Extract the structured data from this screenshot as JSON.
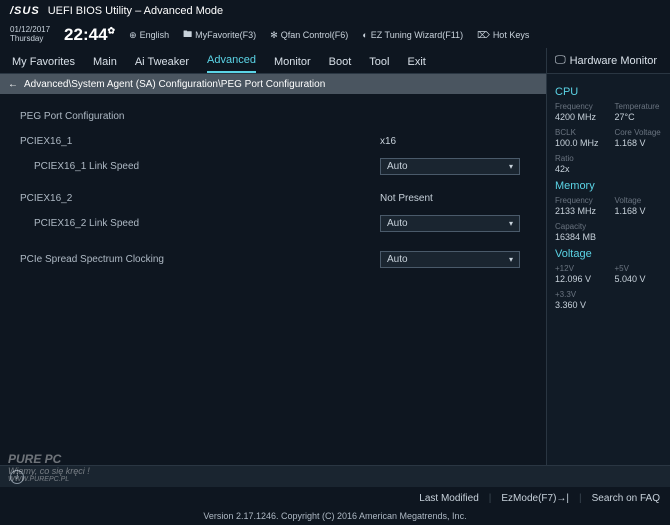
{
  "header": {
    "brand": "/SUS",
    "title": "UEFI BIOS Utility – Advanced Mode"
  },
  "top": {
    "date": "01/12/2017",
    "day": "Thursday",
    "time": "22:44",
    "lang": "English",
    "fav": "MyFavorite(F3)",
    "qfan": "Qfan Control(F6)",
    "ez": "EZ Tuning Wizard(F11)",
    "hot": "Hot Keys"
  },
  "tabs": [
    "My Favorites",
    "Main",
    "Ai Tweaker",
    "Advanced",
    "Monitor",
    "Boot",
    "Tool",
    "Exit"
  ],
  "activeTab": 3,
  "breadcrumb": "Advanced\\System Agent (SA) Configuration\\PEG Port Configuration",
  "rows": {
    "heading": "PEG Port Configuration",
    "p1": "PCIEX16_1",
    "p1v": "x16",
    "p1s": "PCIEX16_1 Link Speed",
    "p1sv": "Auto",
    "p2": "PCIEX16_2",
    "p2v": "Not Present",
    "p2s": "PCIEX16_2 Link Speed",
    "p2sv": "Auto",
    "ssc": "PCIe Spread Spectrum Clocking",
    "sscv": "Auto"
  },
  "hw": {
    "title": "Hardware Monitor",
    "cpu": {
      "h": "CPU",
      "freq_l": "Frequency",
      "freq": "4200 MHz",
      "temp_l": "Temperature",
      "temp": "27°C",
      "bclk_l": "BCLK",
      "bclk": "100.0 MHz",
      "cv_l": "Core Voltage",
      "cv": "1.168 V",
      "ratio_l": "Ratio",
      "ratio": "42x"
    },
    "mem": {
      "h": "Memory",
      "freq_l": "Frequency",
      "freq": "2133 MHz",
      "v_l": "Voltage",
      "v": "1.168 V",
      "cap_l": "Capacity",
      "cap": "16384 MB"
    },
    "volt": {
      "h": "Voltage",
      "v12_l": "+12V",
      "v12": "12.096 V",
      "v5_l": "+5V",
      "v5": "5.040 V",
      "v33_l": "+3.3V",
      "v33": "3.360 V"
    }
  },
  "footer": {
    "last": "Last Modified",
    "ez": "EzMode(F7)",
    "faq": "Search on FAQ"
  },
  "version": "Version 2.17.1246. Copyright (C) 2016 American Megatrends, Inc.",
  "watermark": {
    "l1": "PURE PC",
    "l2": "Wiemy, co się kręci !",
    "l3": "WWW.PUREPC.PL"
  }
}
